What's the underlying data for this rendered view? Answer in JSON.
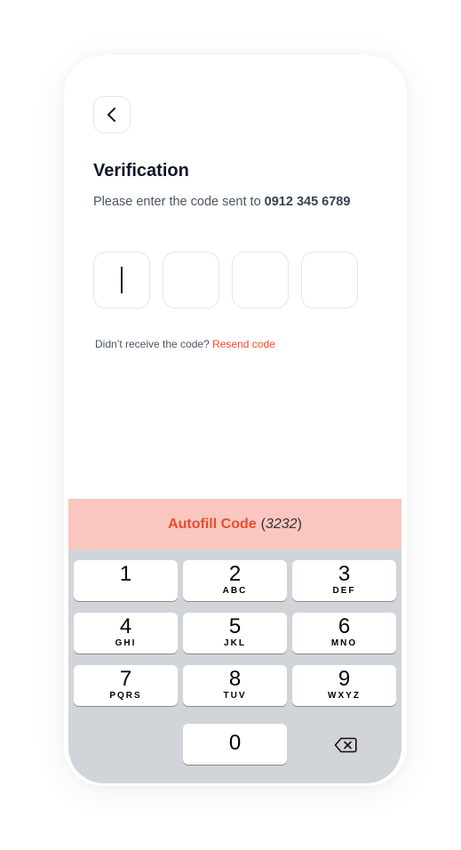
{
  "header": {
    "title": "Verification",
    "subtitle_prefix": "Please enter the code sent to",
    "phone_number": "0912 345 6789"
  },
  "code_inputs": [
    "",
    "",
    "",
    ""
  ],
  "resend": {
    "prompt": "Didn’t receive the code?",
    "link_label": "Resend code"
  },
  "autofill": {
    "label": "Autofill Code",
    "code_open": "(",
    "code": "3232",
    "code_close": ")"
  },
  "keypad": {
    "keys": [
      {
        "num": "1",
        "letters": ""
      },
      {
        "num": "2",
        "letters": "ABC"
      },
      {
        "num": "3",
        "letters": "DEF"
      },
      {
        "num": "4",
        "letters": "GHI"
      },
      {
        "num": "5",
        "letters": "JKL"
      },
      {
        "num": "6",
        "letters": "MNO"
      },
      {
        "num": "7",
        "letters": "PQRS"
      },
      {
        "num": "8",
        "letters": "TUV"
      },
      {
        "num": "9",
        "letters": "WXYZ"
      }
    ],
    "zero": "0"
  },
  "icons": {
    "back": "chevron-left-icon",
    "delete": "backspace-icon"
  },
  "colors": {
    "accent": "#ef4b2b",
    "autofill_bg": "#f9c7bf",
    "keyboard_bg": "#d1d4d9"
  }
}
